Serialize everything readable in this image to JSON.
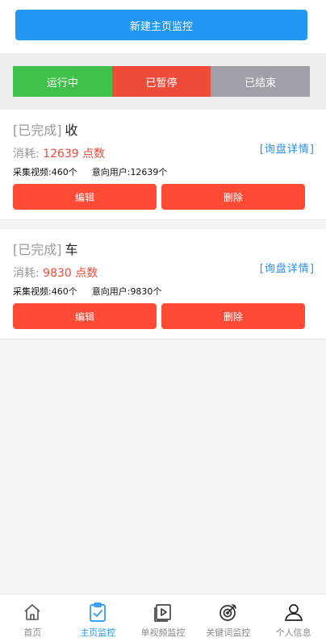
{
  "toolbar": {
    "new_button_label": "新建主页监控"
  },
  "filters": {
    "running": "运行中",
    "paused": "已暂停",
    "ended": "已结束"
  },
  "tasks": [
    {
      "status": "[已完成]",
      "name": "收",
      "cost_label": "消耗:",
      "cost_value": "12639 点数",
      "detail_link": "[询盘详情]",
      "videos_label": "采集视频:",
      "videos_value": "460个",
      "users_label": "意向用户:",
      "users_value": "12639个",
      "edit_label": "编辑",
      "delete_label": "删除"
    },
    {
      "status": "[已完成]",
      "name": "车",
      "cost_label": "消耗:",
      "cost_value": "9830 点数",
      "detail_link": "[询盘详情]",
      "videos_label": "采集视频:",
      "videos_value": "460个",
      "users_label": "意向用户:",
      "users_value": "9830个",
      "edit_label": "编辑",
      "delete_label": "删除"
    }
  ],
  "bottom_nav": [
    {
      "label": "首页",
      "icon": "home-icon",
      "active": false
    },
    {
      "label": "主页监控",
      "icon": "clipboard-check-icon",
      "active": true
    },
    {
      "label": "单视频监控",
      "icon": "video-play-icon",
      "active": false
    },
    {
      "label": "关键词监控",
      "icon": "target-icon",
      "active": false
    },
    {
      "label": "个人信息",
      "icon": "user-icon",
      "active": false
    }
  ],
  "colors": {
    "primary": "#2196f3",
    "running": "#3fc04a",
    "paused": "#f04a3a",
    "ended": "#a09fa8",
    "danger_button": "#ff4a36",
    "link": "#2b8ee6"
  }
}
